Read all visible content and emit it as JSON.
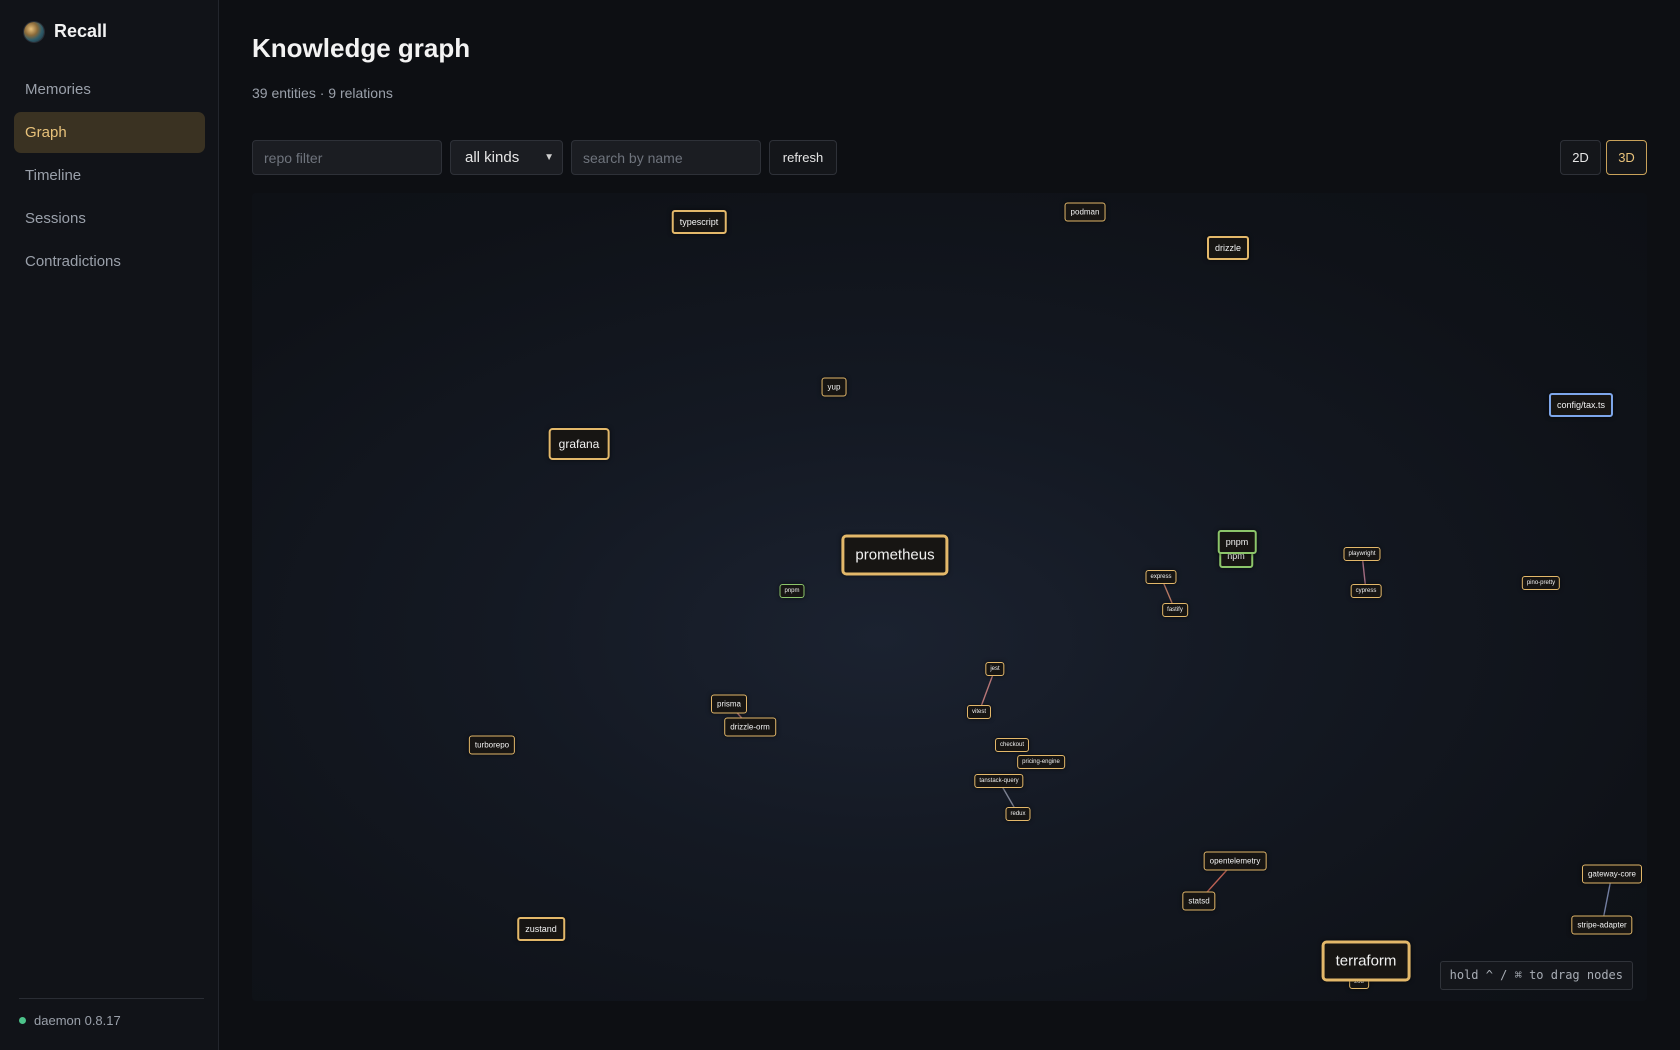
{
  "app": {
    "name": "Recall",
    "logo_icon": "globe-logo-icon"
  },
  "sidebar": {
    "items": [
      {
        "label": "Memories",
        "active": false
      },
      {
        "label": "Graph",
        "active": true
      },
      {
        "label": "Timeline",
        "active": false
      },
      {
        "label": "Sessions",
        "active": false
      },
      {
        "label": "Contradictions",
        "active": false
      }
    ],
    "footer": {
      "status_label": "daemon 0.8.17",
      "status_color": "#4cc38a"
    }
  },
  "page": {
    "title": "Knowledge graph",
    "summary": "39 entities · 9 relations"
  },
  "toolbar": {
    "repo_filter": {
      "value": "",
      "placeholder": "repo filter"
    },
    "kind_select": {
      "value": "all kinds"
    },
    "search": {
      "value": "",
      "placeholder": "search by name"
    },
    "refresh_label": "refresh",
    "view_2d_label": "2D",
    "view_3d_label": "3D",
    "active_view": "3D"
  },
  "graph": {
    "hint": "hold ^ / ⌘ to drag nodes",
    "colors": {
      "default": "#e3b86a",
      "green": "#8cc56a",
      "blue": "#7ea6ea"
    },
    "nodes": [
      {
        "id": "typescript",
        "label": "typescript",
        "tone": "default"
      },
      {
        "id": "podman",
        "label": "podman",
        "tone": "default"
      },
      {
        "id": "drizzle",
        "label": "drizzle",
        "tone": "default"
      },
      {
        "id": "yup",
        "label": "yup",
        "tone": "default"
      },
      {
        "id": "config-tax",
        "label": "config/tax.ts",
        "tone": "blue"
      },
      {
        "id": "grafana",
        "label": "grafana",
        "tone": "default"
      },
      {
        "id": "prometheus",
        "label": "prometheus",
        "tone": "default"
      },
      {
        "id": "pnpm-a",
        "label": "pnpm",
        "tone": "green"
      },
      {
        "id": "npm",
        "label": "npm",
        "tone": "green"
      },
      {
        "id": "pnpm-b",
        "label": "pnpm",
        "tone": "green"
      },
      {
        "id": "playwright",
        "label": "playwright",
        "tone": "default"
      },
      {
        "id": "cypress",
        "label": "cypress",
        "tone": "default"
      },
      {
        "id": "pino-pretty",
        "label": "pino-pretty",
        "tone": "default"
      },
      {
        "id": "express",
        "label": "express",
        "tone": "default"
      },
      {
        "id": "fastify",
        "label": "fastify",
        "tone": "default"
      },
      {
        "id": "jest",
        "label": "jest",
        "tone": "default"
      },
      {
        "id": "vitest",
        "label": "vitest",
        "tone": "default"
      },
      {
        "id": "prisma",
        "label": "prisma",
        "tone": "default"
      },
      {
        "id": "drizzle-orm",
        "label": "drizzle-orm",
        "tone": "default"
      },
      {
        "id": "turborepo",
        "label": "turborepo",
        "tone": "default"
      },
      {
        "id": "checkout",
        "label": "checkout",
        "tone": "default"
      },
      {
        "id": "pricing-engine",
        "label": "pricing-engine",
        "tone": "default"
      },
      {
        "id": "tanstack-query",
        "label": "tanstack-query",
        "tone": "default"
      },
      {
        "id": "redux",
        "label": "redux",
        "tone": "default"
      },
      {
        "id": "opentelemetry",
        "label": "opentelemetry",
        "tone": "default"
      },
      {
        "id": "statsd",
        "label": "statsd",
        "tone": "default"
      },
      {
        "id": "gateway-core",
        "label": "gateway-core",
        "tone": "default"
      },
      {
        "id": "stripe-adapter",
        "label": "stripe-adapter",
        "tone": "default"
      },
      {
        "id": "zustand",
        "label": "zustand",
        "tone": "default"
      },
      {
        "id": "zod",
        "label": "zod",
        "tone": "default"
      },
      {
        "id": "terraform",
        "label": "terraform",
        "tone": "default"
      }
    ],
    "edges": [
      {
        "from": "express",
        "to": "fastify",
        "color": "#c9826a"
      },
      {
        "from": "playwright",
        "to": "cypress",
        "color": "#b0748a"
      },
      {
        "from": "jest",
        "to": "vitest",
        "color": "#c98080"
      },
      {
        "from": "prisma",
        "to": "drizzle-orm",
        "color": "#c98080"
      },
      {
        "from": "tanstack-query",
        "to": "redux",
        "color": "#8a8fa0"
      },
      {
        "from": "opentelemetry",
        "to": "statsd",
        "color": "#d06a5a"
      },
      {
        "from": "gateway-core",
        "to": "stripe-adapter",
        "color": "#7e8ab0"
      },
      {
        "from": "npm",
        "to": "pnpm-b",
        "color": "#8cc56a"
      },
      {
        "from": "terraform",
        "to": "zod",
        "color": "#b89a60"
      }
    ]
  }
}
